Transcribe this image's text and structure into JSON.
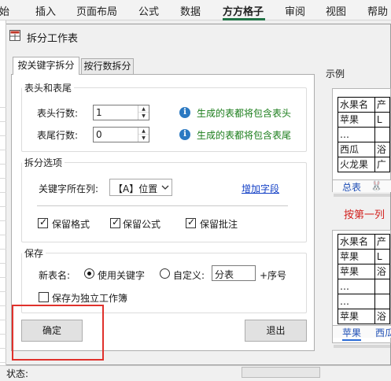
{
  "ribbon": {
    "tabs": [
      "始",
      "插入",
      "页面布局",
      "公式",
      "数据",
      "方方格子",
      "审阅",
      "视图",
      "帮助"
    ],
    "active_tab": "方方格子",
    "accent_color": "#217346"
  },
  "dialog": {
    "title": "拆分工作表",
    "tabs": [
      "按关键字拆分",
      "按行数拆分"
    ],
    "active_tab_index": 0,
    "header_footer": {
      "legend": "表头和表尾",
      "header_rows_label": "表头行数:",
      "header_rows_value": "1",
      "header_tip": "生成的表都将包含表头",
      "footer_rows_label": "表尾行数:",
      "footer_rows_value": "0",
      "footer_tip": "生成的表都将包含表尾",
      "info_glyph": "i"
    },
    "split_options": {
      "legend": "拆分选项",
      "key_column_label": "关键字所在列:",
      "key_column_value": "【A】位置",
      "add_field_link": "增加字段",
      "keep_format": {
        "label": "保留格式",
        "checked": true
      },
      "keep_formula": {
        "label": "保留公式",
        "checked": true
      },
      "keep_comment": {
        "label": "保留批注",
        "checked": true
      }
    },
    "save": {
      "legend": "保存",
      "new_sheet_name_label": "新表名:",
      "use_keyword": {
        "label": "使用关键字",
        "selected": true
      },
      "custom": {
        "label": "自定义:",
        "selected": false,
        "value": "分表"
      },
      "suffix": "+序号",
      "save_as_workbook": {
        "label": "保存为独立工作簿",
        "checked": false
      }
    },
    "buttons": {
      "ok": "确定",
      "exit": "退出"
    },
    "highlight_color": "#e0312c"
  },
  "example": {
    "label": "示例",
    "top_table": {
      "rows": [
        [
          "水果名",
          "产"
        ],
        [
          "苹果",
          "L"
        ],
        [
          "…",
          ""
        ],
        [
          "西瓜",
          "浴"
        ],
        [
          "火龙果",
          "广"
        ]
      ],
      "tabs": [
        "总表",
        "🐰"
      ]
    },
    "arrow_text": "按第一列",
    "bottom_table": {
      "rows": [
        [
          "水果名",
          "产"
        ],
        [
          "苹果",
          "L"
        ],
        [
          "苹果",
          "浴"
        ],
        [
          "…",
          ""
        ],
        [
          "…",
          ""
        ],
        [
          "苹果",
          "浴"
        ]
      ],
      "tabs": [
        "苹果",
        "西瓜"
      ]
    }
  },
  "statusbar": {
    "label": "状态:"
  }
}
